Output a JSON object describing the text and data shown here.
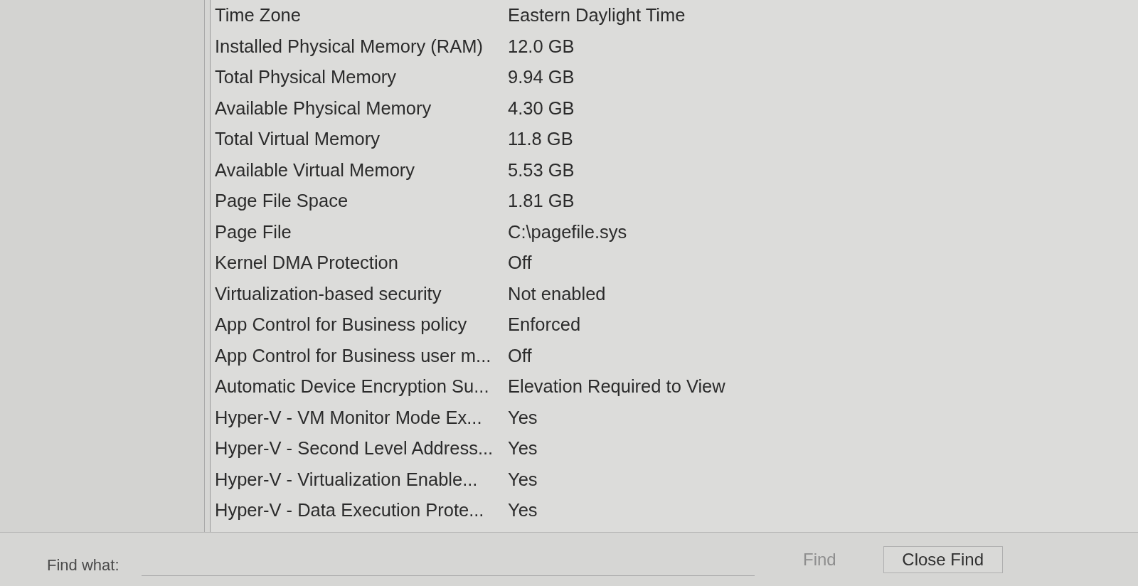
{
  "list": {
    "rows": [
      {
        "item": "Time Zone",
        "value": "Eastern Daylight Time"
      },
      {
        "item": "Installed Physical Memory (RAM)",
        "value": "12.0 GB"
      },
      {
        "item": "Total Physical Memory",
        "value": "9.94 GB"
      },
      {
        "item": "Available Physical Memory",
        "value": "4.30 GB"
      },
      {
        "item": "Total Virtual Memory",
        "value": "11.8 GB"
      },
      {
        "item": "Available Virtual Memory",
        "value": "5.53 GB"
      },
      {
        "item": "Page File Space",
        "value": "1.81 GB"
      },
      {
        "item": "Page File",
        "value": "C:\\pagefile.sys"
      },
      {
        "item": "Kernel DMA Protection",
        "value": "Off"
      },
      {
        "item": "Virtualization-based security",
        "value": "Not enabled"
      },
      {
        "item": "App Control for Business policy",
        "value": "Enforced"
      },
      {
        "item": "App Control for Business user m...",
        "value": "Off"
      },
      {
        "item": "Automatic Device Encryption Su...",
        "value": "Elevation Required to View"
      },
      {
        "item": "Hyper-V - VM Monitor Mode Ex...",
        "value": "Yes"
      },
      {
        "item": "Hyper-V - Second Level Address...",
        "value": "Yes"
      },
      {
        "item": "Hyper-V - Virtualization Enable...",
        "value": "Yes"
      },
      {
        "item": "Hyper-V - Data Execution Prote...",
        "value": "Yes"
      }
    ]
  },
  "find_bar": {
    "label": "Find what:",
    "buttons": [
      {
        "label": "Find",
        "disabled": true
      },
      {
        "label": "Close Find",
        "disabled": false
      }
    ]
  }
}
